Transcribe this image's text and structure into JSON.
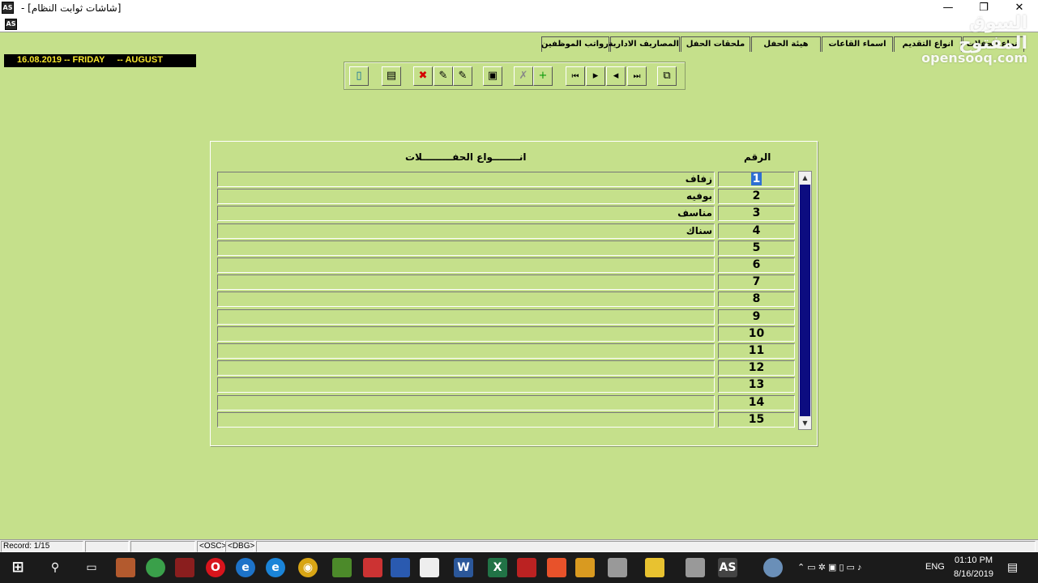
{
  "window": {
    "title": "[شاشات ثوابت النظام] -",
    "minimize": "—",
    "restore": "❐",
    "close": "✕",
    "app_icon_label": "AS"
  },
  "tabs": [
    "انواع الحفلات",
    "انواع التقديم",
    "اسماء القاعات",
    "هيئة الحفل",
    "ملحقات الحفل",
    "المصاريف الادارية",
    "رواتب الموظفين"
  ],
  "date_bar": "16.08.2019 -- FRIDAY     -- AUGUST",
  "toolbar": {
    "buttons": [
      {
        "name": "exit-icon",
        "glyph": "▯"
      },
      {
        "name": "print-icon",
        "glyph": "▤"
      },
      {
        "name": "delete-icon",
        "glyph": "✖",
        "color": "#d40000"
      },
      {
        "name": "edit-icon",
        "glyph": "✎"
      },
      {
        "name": "edit-alt-icon",
        "glyph": "✎"
      },
      {
        "name": "save-icon",
        "glyph": "▣"
      },
      {
        "name": "clear-icon",
        "glyph": "✗"
      },
      {
        "name": "add-record-icon",
        "glyph": "+",
        "color": "#0a9a0a"
      },
      {
        "name": "first-record-icon",
        "glyph": "⏮"
      },
      {
        "name": "next-record-icon",
        "glyph": "▸"
      },
      {
        "name": "previous-record-icon",
        "glyph": "◂"
      },
      {
        "name": "last-record-icon",
        "glyph": "⏭"
      },
      {
        "name": "copy-icon",
        "glyph": "⧉"
      }
    ]
  },
  "grid": {
    "header_number": "الرقم",
    "header_type": "انــــــــواع الحفـــــــــلات",
    "selected_row": 1,
    "rows": [
      {
        "num": "1",
        "type": "زفاف"
      },
      {
        "num": "2",
        "type": "بوفيه"
      },
      {
        "num": "3",
        "type": "مناسف"
      },
      {
        "num": "4",
        "type": "سناك"
      },
      {
        "num": "5",
        "type": ""
      },
      {
        "num": "6",
        "type": ""
      },
      {
        "num": "7",
        "type": ""
      },
      {
        "num": "8",
        "type": ""
      },
      {
        "num": "9",
        "type": ""
      },
      {
        "num": "10",
        "type": ""
      },
      {
        "num": "11",
        "type": ""
      },
      {
        "num": "12",
        "type": ""
      },
      {
        "num": "13",
        "type": ""
      },
      {
        "num": "14",
        "type": ""
      },
      {
        "num": "15",
        "type": ""
      }
    ]
  },
  "status": {
    "record": "Record: 1/15",
    "osc": "<OSC>",
    "dbg": "<DBG>"
  },
  "watermark": {
    "arabic": "السوق المفتوح",
    "latin": "opensooq.com"
  },
  "taskbar": {
    "lang": "ENG",
    "time": "01:10 PM",
    "date": "8/16/2019"
  },
  "colors": {
    "background": "#c5e08b",
    "date_text": "#f5e52c",
    "scroll_fill": "#0c0c80",
    "selection": "#2f6fd3"
  }
}
